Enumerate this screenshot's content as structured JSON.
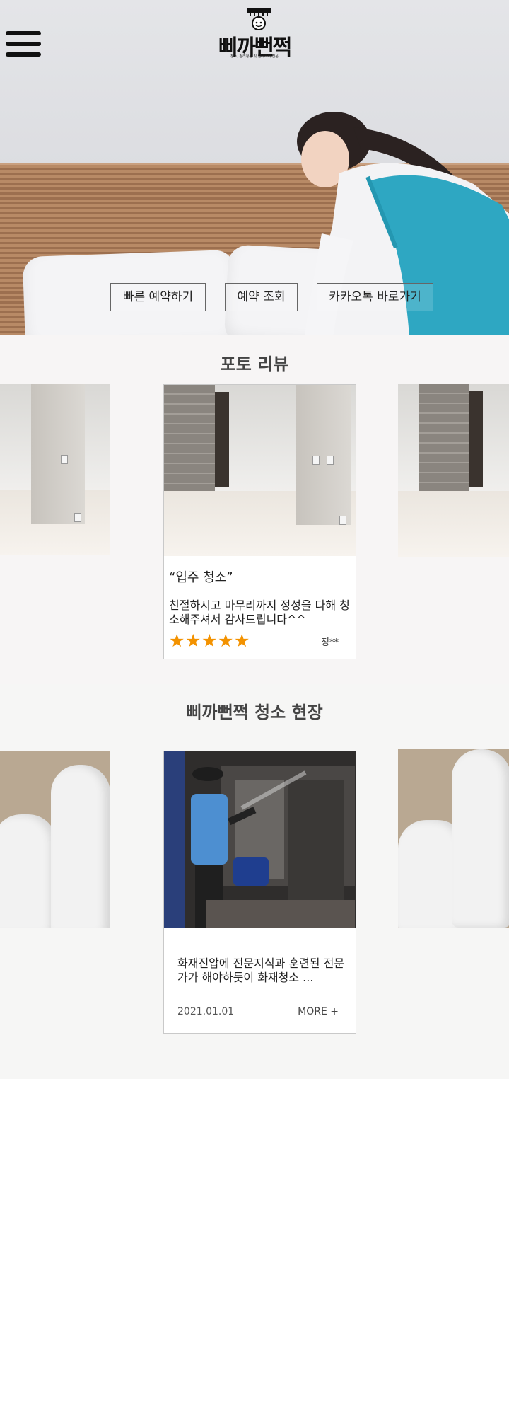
{
  "header": {
    "menu_icon": "hamburger-menu-icon",
    "logo_text": "삐까뻔쩍",
    "logo_subtitle": "청소, 정리정돈 및 인테리어 전문"
  },
  "hero": {
    "buttons": [
      {
        "label": "빠른 예약하기"
      },
      {
        "label": "예약 조회"
      },
      {
        "label": "카카오톡 바로가기"
      }
    ]
  },
  "photo_reviews": {
    "title": "포토 리뷰",
    "active_review": {
      "title": "“입주 청소”",
      "text": "친절하시고 마무리까지 정성을 다해 청소해주셔서 감사드립니다^^",
      "rating": 5,
      "reviewer": "정**",
      "star_color": "#f39200"
    }
  },
  "cleaning_site": {
    "title": "삐까뻔쩍 청소 현장",
    "active_post": {
      "text": "화재진압에 전문지식과 훈련된 전문가가 해야하듯이 화재청소 ...",
      "date": "2021.01.01",
      "more_label": "MORE  +"
    }
  }
}
